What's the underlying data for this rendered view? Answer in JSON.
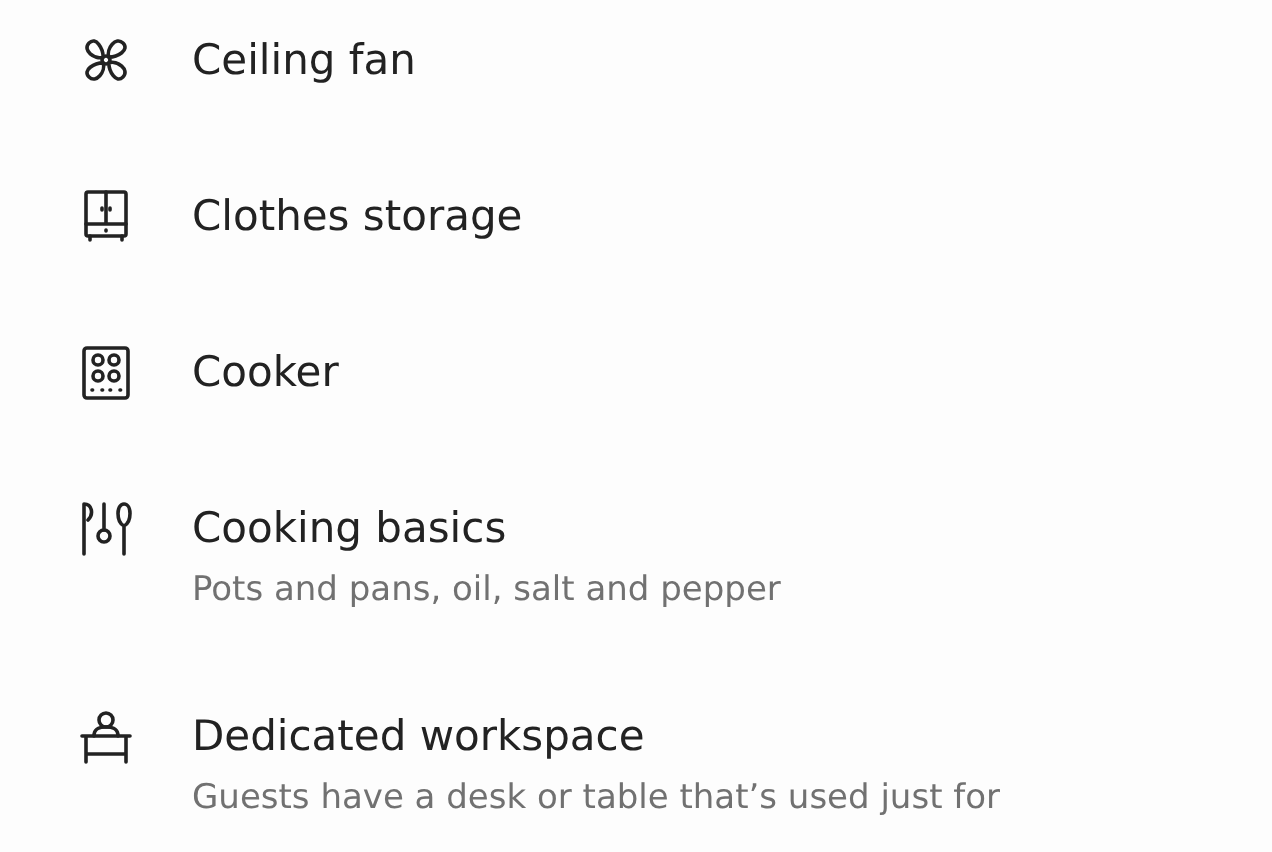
{
  "amenities": [
    {
      "kind": "fan",
      "title": "Ceiling fan"
    },
    {
      "kind": "wardrobe",
      "title": "Clothes storage"
    },
    {
      "kind": "cooker",
      "title": "Cooker"
    },
    {
      "kind": "utensils",
      "title": "Cooking basics",
      "subtitle": "Pots and pans, oil, salt and pepper"
    },
    {
      "kind": "desk",
      "title": "Dedicated workspace",
      "subtitle": "Guests have a desk or table that’s used just for"
    }
  ]
}
